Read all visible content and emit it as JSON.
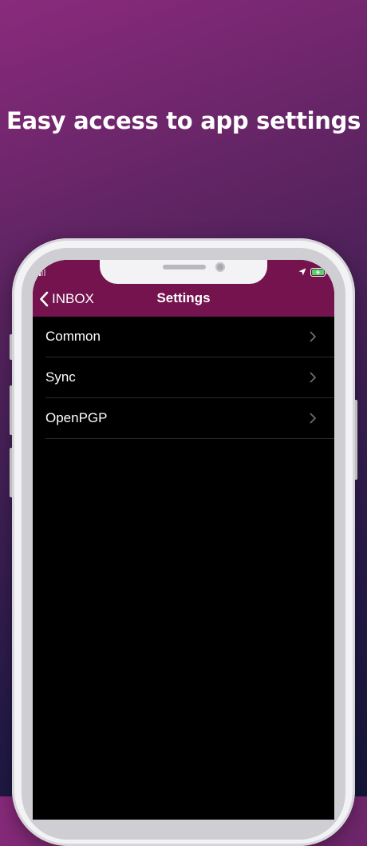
{
  "promo": {
    "headline": "Easy access to app settings"
  },
  "colors": {
    "navbar": "#74134e",
    "screen_background": "#000000",
    "separator": "#2a2a2c",
    "chevron": "#6d6d72",
    "battery_charging": "#4cd964"
  },
  "status_bar": {
    "signal_icon": "cellular-signal-icon",
    "location_icon": "location-arrow-icon",
    "battery_icon": "battery-charging-icon"
  },
  "navbar": {
    "back_label": "INBOX",
    "back_icon": "chevron-left-icon",
    "title": "Settings"
  },
  "settings": {
    "items": [
      {
        "label": "Common",
        "icon": "chevron-right-icon"
      },
      {
        "label": "Sync",
        "icon": "chevron-right-icon"
      },
      {
        "label": "OpenPGP",
        "icon": "chevron-right-icon"
      }
    ]
  }
}
